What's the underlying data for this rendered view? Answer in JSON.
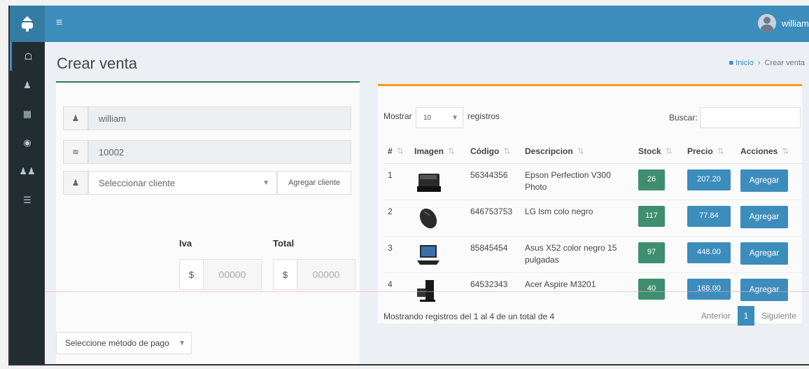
{
  "header": {
    "user_name": "william"
  },
  "sidebar": {
    "icons": [
      "home-icon",
      "user-icon",
      "grid-icon",
      "product-icon",
      "users-icon",
      "list-icon"
    ]
  },
  "page": {
    "title": "Crear venta"
  },
  "breadcrumb": {
    "home": "Inicio",
    "current": "Crear venta"
  },
  "form": {
    "seller": "william",
    "code": "10002",
    "client_select": "Seleccionar cliente",
    "add_client_label": "Agregar cliente",
    "iva_label": "Iva",
    "total_label": "Total",
    "currency_symbol": "$",
    "iva_value": "00000",
    "total_value": "00000",
    "payment_method": "Seleccione método de pago"
  },
  "table_controls": {
    "show_label": "Mostrar",
    "page_length": "10",
    "records_label": "registros",
    "search_label": "Buscar:"
  },
  "table": {
    "columns": [
      "#",
      "Imagen",
      "Código",
      "Descripcion",
      "Stock",
      "Precio",
      "Acciones"
    ],
    "rows": [
      {
        "num": "1",
        "code": "56344356",
        "desc": "Epson Perfection V300 Photo",
        "stock": "26",
        "price": "207.20",
        "action": "Agregar"
      },
      {
        "num": "2",
        "code": "646753753",
        "desc": "LG lsm colo negro",
        "stock": "117",
        "price": "77.84",
        "action": "Agregar"
      },
      {
        "num": "3",
        "code": "85845454",
        "desc": "Asus X52 color negro 15 pulgadas",
        "stock": "97",
        "price": "448.00",
        "action": "Agregar"
      },
      {
        "num": "4",
        "code": "64532343",
        "desc": "Acer Aspire M3201",
        "stock": "40",
        "price": "168.00",
        "action": "Agregar"
      }
    ]
  },
  "pagination": {
    "info": "Mostrando registros del 1 al 4 de un total de 4",
    "prev": "Anterior",
    "page": "1",
    "next": "Siguiente"
  },
  "colors": {
    "primary": "#3c8dbc",
    "success": "#3f8e6f",
    "warning": "#f39c12",
    "sidebar": "#222d32"
  }
}
